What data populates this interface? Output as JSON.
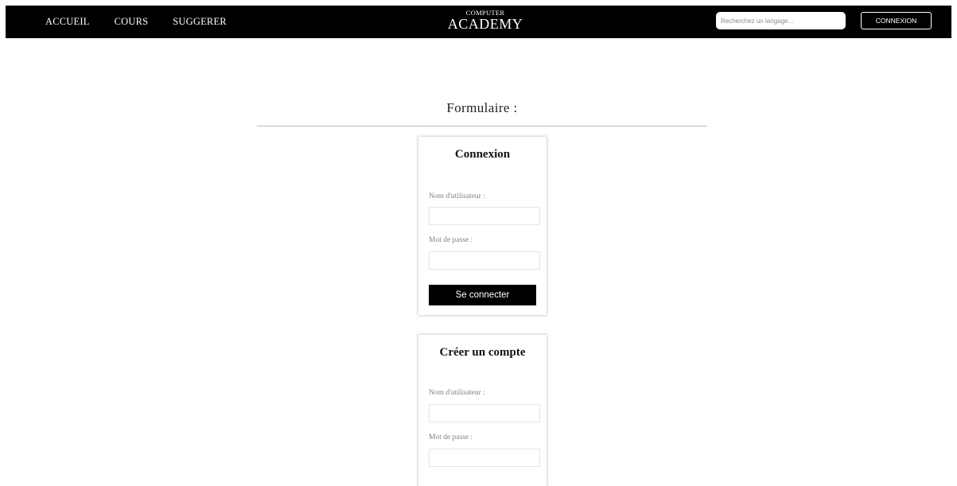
{
  "nav": {
    "links": [
      "ACCUEIL",
      "COURS",
      "SUGGERER"
    ],
    "logo_top": "COMPUTER",
    "logo_bottom": "ACADEMY",
    "search_placeholder": "Recherchez un langage...",
    "login_label": "CONNEXION"
  },
  "page": {
    "heading": "Formulaire :"
  },
  "login_form": {
    "title": "Connexion",
    "username_label": "Nom d'utilisateur :",
    "password_label": "Mot de passe :",
    "submit_label": "Se connecter"
  },
  "register_form": {
    "title": "Créer un compte",
    "username_label": "Nom d'utilisateur :",
    "password_label": "Mot de passe :"
  }
}
